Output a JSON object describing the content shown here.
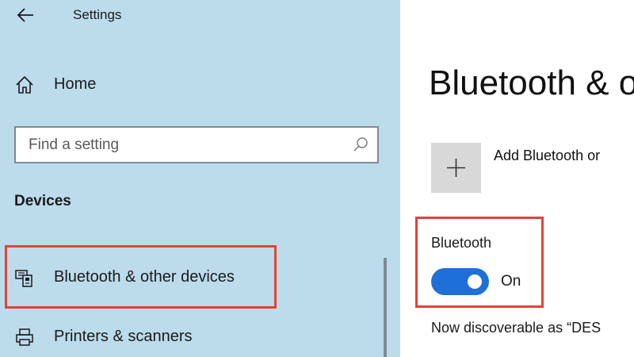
{
  "window": {
    "title": "Settings"
  },
  "sidebar": {
    "home_label": "Home",
    "search": {
      "placeholder": "Find a setting"
    },
    "section_heading": "Devices",
    "items": [
      {
        "label": "Bluetooth & other devices",
        "icon": "keyboard-device-icon",
        "selected": true
      },
      {
        "label": "Printers & scanners",
        "icon": "printer-icon",
        "selected": false
      }
    ]
  },
  "main": {
    "title": "Bluetooth & o",
    "add_device_label": "Add Bluetooth or",
    "bluetooth": {
      "label": "Bluetooth",
      "toggle_state": "On",
      "enabled": true
    },
    "discoverable_text": "Now discoverable as “DES"
  },
  "colors": {
    "sidebar_bg": "#bcdcec",
    "highlight": "#e04436",
    "toggle_on": "#1f6fd8",
    "add_tile_bg": "#d8d8d8"
  }
}
